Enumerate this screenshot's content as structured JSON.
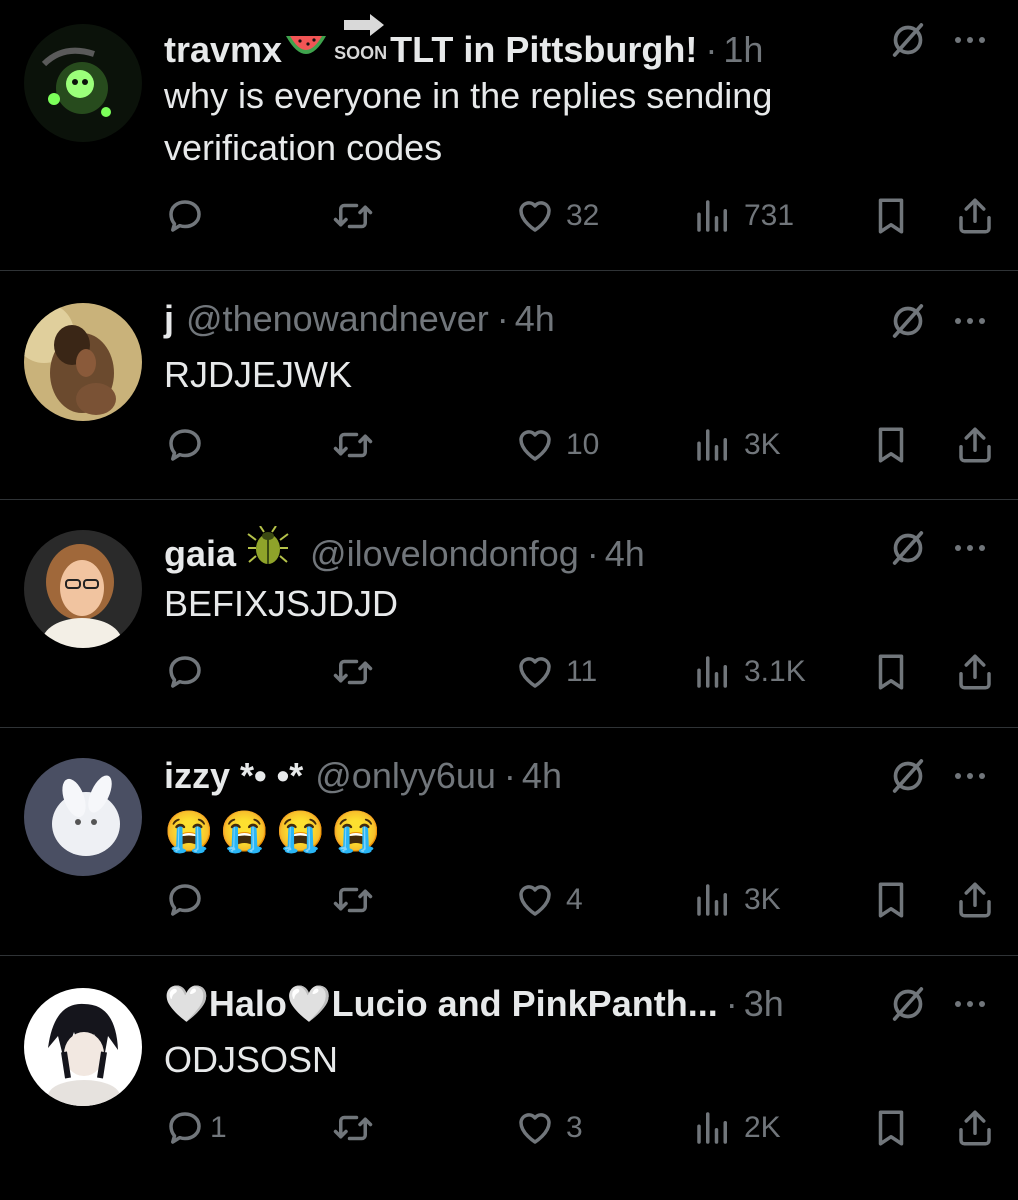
{
  "posts": [
    {
      "name": "travmx",
      "handle": "",
      "name_suffix": "TLT in Pittsburgh!",
      "soon_badge": "SOON",
      "time": "1h",
      "text": [
        "why is everyone in the replies sending",
        "verification codes"
      ],
      "reply_count": "",
      "like_count": "32",
      "view_count": "731",
      "avatar": "green-glow-avatar"
    },
    {
      "name": "j",
      "handle": "@thenowandnever",
      "time": "4h",
      "text": [
        "RJDJEJWK"
      ],
      "reply_count": "",
      "like_count": "10",
      "view_count": "3K",
      "avatar": "person-avatar"
    },
    {
      "name": "gaia",
      "handle": "@ilovelondonfog",
      "time": "4h",
      "text": [
        "BEFIXJSJDJD"
      ],
      "reply_count": "",
      "like_count": "11",
      "view_count": "3.1K",
      "avatar": "girl-glasses-avatar"
    },
    {
      "name": "izzy *• •*",
      "handle": "@onlyy6uu",
      "time": "4h",
      "text": [
        "😭😭😭😭"
      ],
      "reply_count": "",
      "like_count": "4",
      "view_count": "3K",
      "avatar": "white-bunny-avatar"
    },
    {
      "name": "🤍Halo🤍Lucio and PinkPanth...",
      "handle": "",
      "time": "3h",
      "text": [
        "ODJSOSN"
      ],
      "reply_count": "1",
      "like_count": "3",
      "view_count": "2K",
      "avatar": "anime-avatar"
    }
  ],
  "separator": "·",
  "colors": {
    "background": "#000000",
    "text": "#e7e9ea",
    "muted": "#71767b",
    "divider": "#2f3336"
  }
}
